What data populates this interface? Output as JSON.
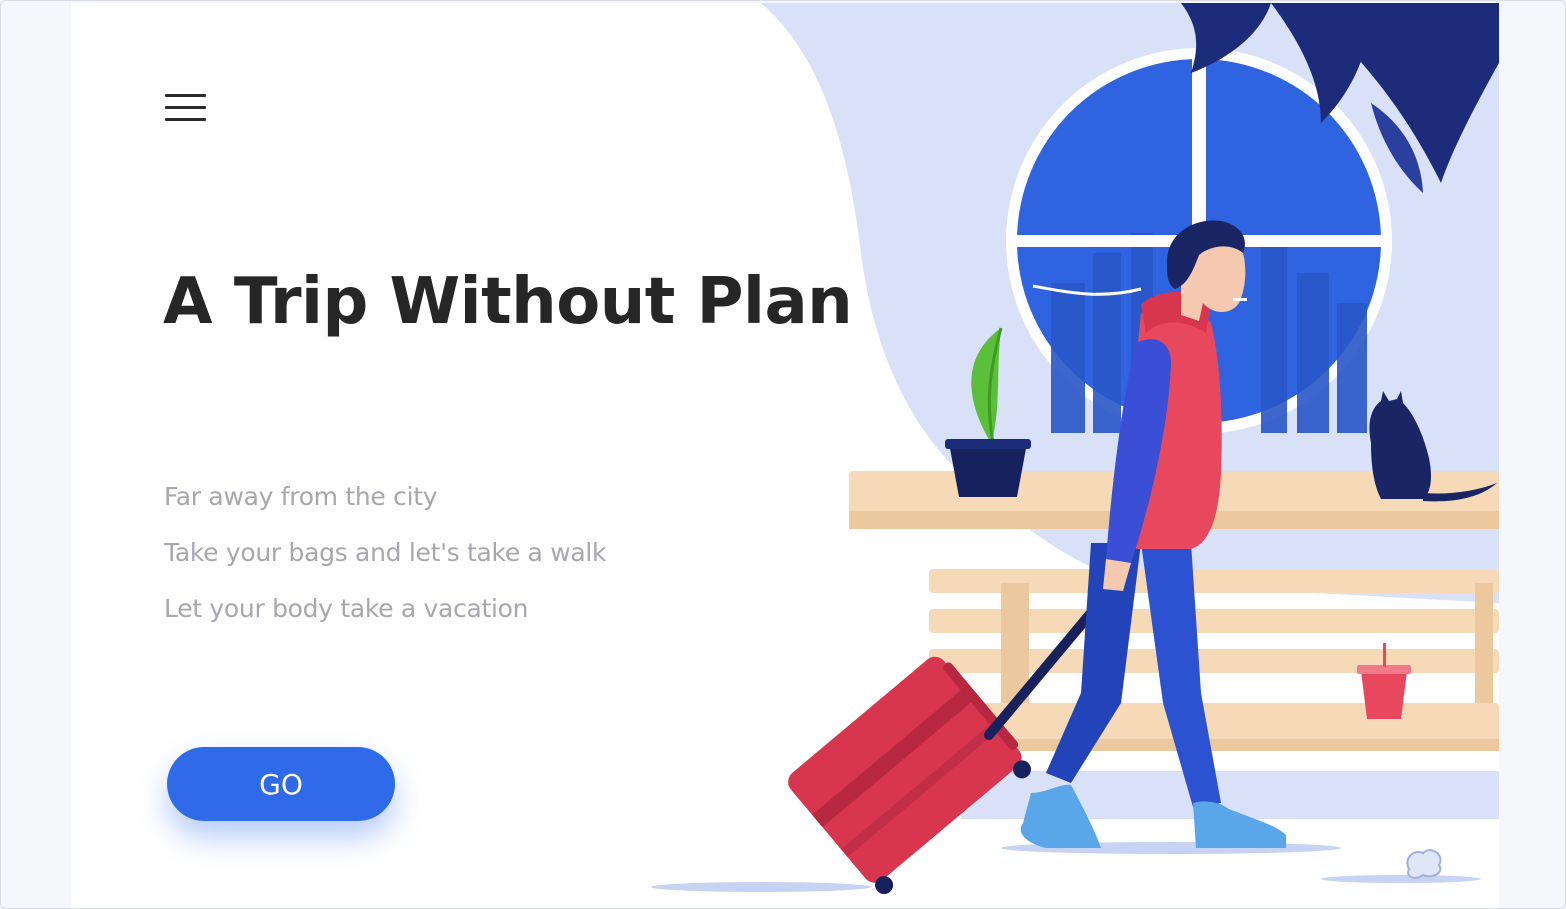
{
  "hero": {
    "title": "A Trip Without Plan",
    "taglines": [
      "Far away from the city",
      "Take your bags and let's take a walk",
      "Let your body take a vacation"
    ],
    "cta_label": "GO"
  },
  "icons": {
    "menu": "hamburger-menu-icon"
  },
  "colors": {
    "accent": "#2f6ae8",
    "title": "#262626",
    "tagline": "#a7a7af",
    "backdrop": "#d8e1f8",
    "suitcase": "#d8364f",
    "hoodie": "#e8485e",
    "bench": "#f6d9b7"
  }
}
